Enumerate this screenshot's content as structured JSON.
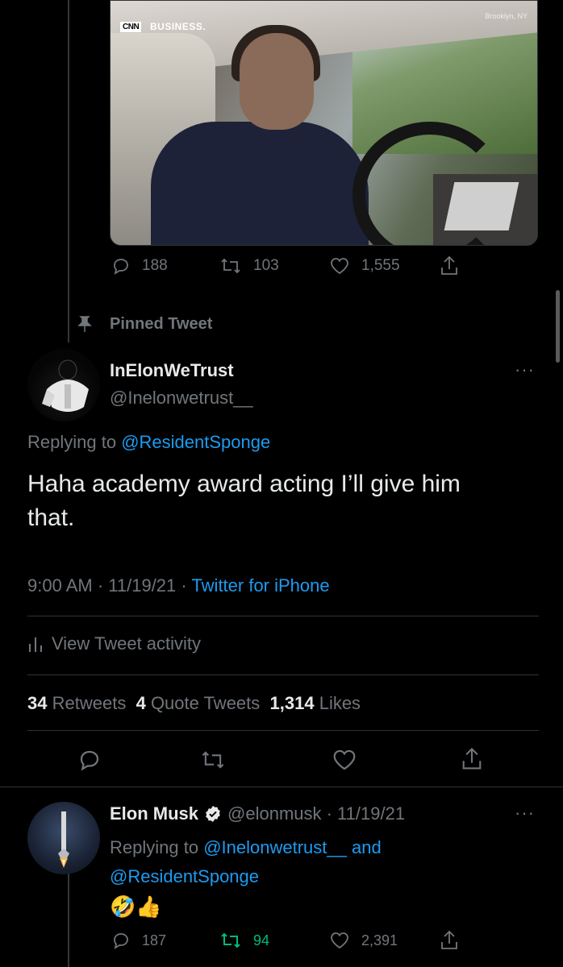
{
  "video": {
    "source_logo": "CNN",
    "source_label": "BUSINESS.",
    "location": "Brooklyn, NY"
  },
  "parent_actions": {
    "replies": "188",
    "retweets": "103",
    "likes": "1,555"
  },
  "pinned_label": "Pinned Tweet",
  "main_tweet": {
    "display_name": "InElonWeTrust",
    "handle": "@Inelonwetrust__",
    "replying_prefix": "Replying to",
    "replying_to": "@ResidentSponge",
    "text": "Haha academy award acting I’ll give him that.",
    "timestamp": "9:00 AM · 11/19/21 ·",
    "client": "Twitter for iPhone",
    "activity_label": "View Tweet activity",
    "stats": {
      "retweets_count": "34",
      "retweets_label": "Retweets",
      "quotes_count": "4",
      "quotes_label": "Quote Tweets",
      "likes_count": "1,314",
      "likes_label": "Likes"
    }
  },
  "reply_tweet": {
    "display_name": "Elon Musk",
    "handle_date": "@elonmusk · 11/19/21",
    "replying_prefix": "Replying to",
    "replying_to_1": "@Inelonwetrust__",
    "and_word": "and",
    "replying_to_2": "@ResidentSponge",
    "emoji": "🤣👍",
    "replies": "187",
    "retweets": "94",
    "likes": "2,391"
  },
  "colors": {
    "background": "#000000",
    "text": "#e7e9ea",
    "secondary": "#71767b",
    "link": "#1d9bf0",
    "retweet_active": "#00ba7c",
    "divider": "#2f3336"
  }
}
